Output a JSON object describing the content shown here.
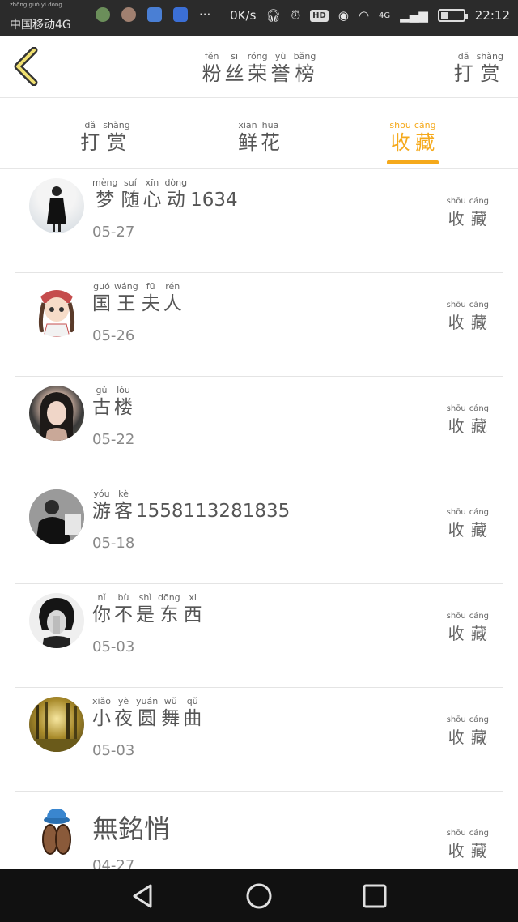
{
  "status_bar": {
    "carrier": "中国移动4G",
    "carrier_pinyin": "zhōng guó yí dòng",
    "speed": "0K/s",
    "hd": "HD",
    "network": "4G",
    "time": "22:12"
  },
  "header": {
    "title_chars": [
      {
        "py": "fěn",
        "hz": "粉"
      },
      {
        "py": "sī",
        "hz": "丝"
      },
      {
        "py": "róng",
        "hz": "荣"
      },
      {
        "py": "yù",
        "hz": "誉"
      },
      {
        "py": "bǎng",
        "hz": "榜"
      }
    ],
    "reward_chars": [
      {
        "py": "dǎ",
        "hz": "打"
      },
      {
        "py": "shǎng",
        "hz": "赏"
      }
    ]
  },
  "tabs": [
    {
      "chars": [
        {
          "py": "dǎ",
          "hz": "打"
        },
        {
          "py": "shǎng",
          "hz": "赏"
        }
      ],
      "active": false
    },
    {
      "chars": [
        {
          "py": "xiān",
          "hz": "鲜"
        },
        {
          "py": "huā",
          "hz": "花"
        }
      ],
      "active": false
    },
    {
      "chars": [
        {
          "py": "shōu",
          "hz": "收"
        },
        {
          "py": "cáng",
          "hz": "藏"
        }
      ],
      "active": true
    }
  ],
  "action_chars": [
    {
      "py": "shōu",
      "hz": "收"
    },
    {
      "py": "cáng",
      "hz": "藏"
    }
  ],
  "rows": [
    {
      "name_chars": [
        {
          "py": "mèng",
          "hz": "梦"
        },
        {
          "py": "suí",
          "hz": "随"
        },
        {
          "py": "xīn",
          "hz": "心"
        },
        {
          "py": "dòng",
          "hz": "动"
        }
      ],
      "name_suffix": "1634",
      "date": "05-27"
    },
    {
      "name_chars": [
        {
          "py": "guó",
          "hz": "国"
        },
        {
          "py": "wáng",
          "hz": "王"
        },
        {
          "py": "fū",
          "hz": "夫"
        },
        {
          "py": "rén",
          "hz": "人"
        }
      ],
      "name_suffix": "",
      "date": "05-26"
    },
    {
      "name_chars": [
        {
          "py": "gǔ",
          "hz": "古"
        },
        {
          "py": "lóu",
          "hz": "楼"
        }
      ],
      "name_suffix": "",
      "date": "05-22"
    },
    {
      "name_chars": [
        {
          "py": "yóu",
          "hz": "游"
        },
        {
          "py": "kè",
          "hz": "客"
        }
      ],
      "name_suffix": "1558113281835",
      "date": "05-18"
    },
    {
      "name_chars": [
        {
          "py": "nǐ",
          "hz": "你"
        },
        {
          "py": "bù",
          "hz": "不"
        },
        {
          "py": "shì",
          "hz": "是"
        },
        {
          "py": "dōng",
          "hz": "东"
        },
        {
          "py": "xi",
          "hz": "西"
        }
      ],
      "name_suffix": "",
      "date": "05-03"
    },
    {
      "name_chars": [
        {
          "py": "xiǎo",
          "hz": "小"
        },
        {
          "py": "yè",
          "hz": "夜"
        },
        {
          "py": "yuán",
          "hz": "圆"
        },
        {
          "py": "wǔ",
          "hz": "舞"
        },
        {
          "py": "qǔ",
          "hz": "曲"
        }
      ],
      "name_suffix": "",
      "date": "05-03"
    },
    {
      "plain_name": "無銘悄",
      "date": "04-27"
    }
  ],
  "colors": {
    "accent": "#f5a91b",
    "text": "#555555",
    "divider": "#e4e4e4"
  }
}
